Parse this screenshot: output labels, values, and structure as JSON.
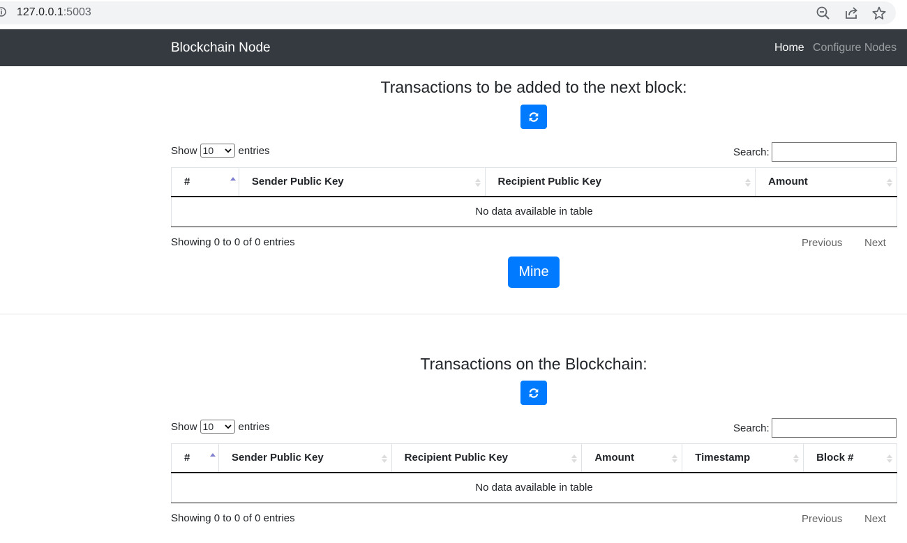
{
  "browser": {
    "url_host": "127.0.0.1",
    "url_port": ":5003",
    "icons": [
      "info-icon",
      "zoom-icon",
      "share-icon",
      "star-icon"
    ]
  },
  "navbar": {
    "brand": "Blockchain Node",
    "links": [
      {
        "label": "Home",
        "active": true
      },
      {
        "label": "Configure Nodes",
        "active": false
      }
    ]
  },
  "pending": {
    "title": "Transactions to be added to the next block:",
    "refresh_icon": "refresh-icon",
    "length": {
      "before": "Show",
      "value": "10",
      "after": "entries"
    },
    "search_label": "Search:",
    "search_value": "",
    "columns": [
      "#",
      "Sender Public Key",
      "Recipient Public Key",
      "Amount"
    ],
    "empty_text": "No data available in table",
    "info": "Showing 0 to 0 of 0 entries",
    "prev": "Previous",
    "next": "Next",
    "mine_label": "Mine"
  },
  "chain": {
    "title": "Transactions on the Blockchain:",
    "refresh_icon": "refresh-icon",
    "length": {
      "before": "Show",
      "value": "10",
      "after": "entries"
    },
    "search_label": "Search:",
    "search_value": "",
    "columns": [
      "#",
      "Sender Public Key",
      "Recipient Public Key",
      "Amount",
      "Timestamp",
      "Block #"
    ],
    "empty_text": "No data available in table",
    "info": "Showing 0 to 0 of 0 entries",
    "prev": "Previous",
    "next": "Next"
  },
  "colors": {
    "navbar_bg": "#343a40",
    "primary": "#007bff"
  }
}
